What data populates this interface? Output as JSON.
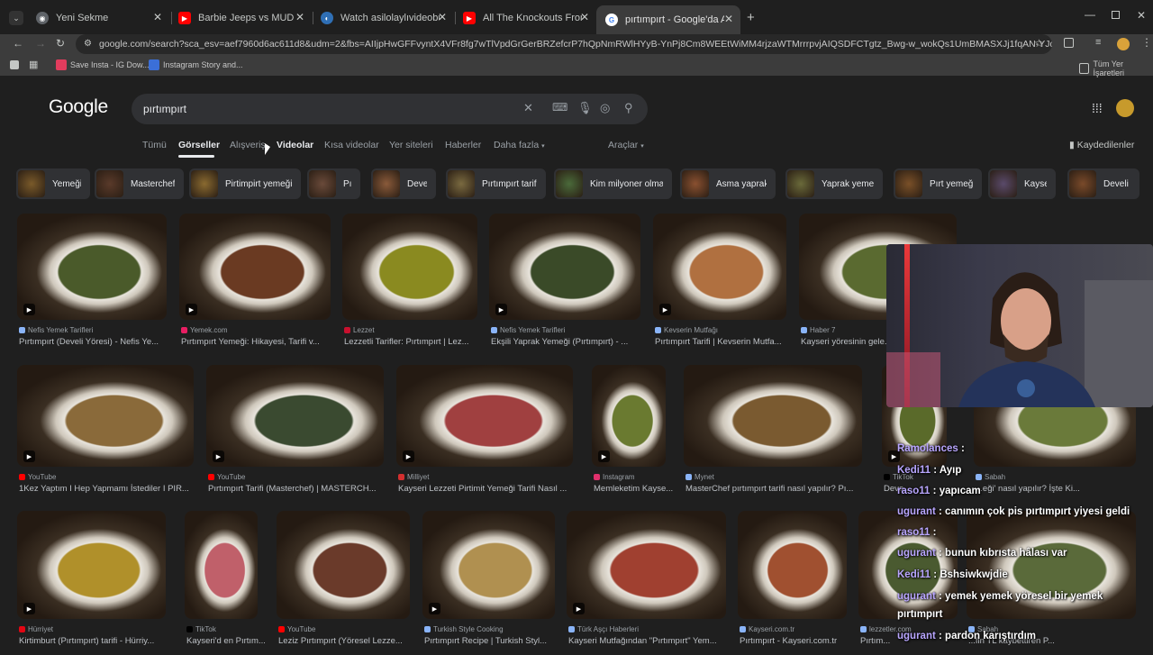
{
  "tabs": [
    {
      "title": "Yeni Sekme",
      "color": "#5f6368"
    },
    {
      "title": "Barbie Jeeps vs MUD HILL (Big",
      "color": "#ff0000"
    },
    {
      "title": "Watch asilolaylıvideobu | Strea",
      "color": "#2f6fb5"
    },
    {
      "title": "All The Knockouts From Battleb",
      "color": "#ff0000"
    },
    {
      "title": "pırtımpırt - Google'da Ara",
      "color": "#ffffff"
    }
  ],
  "address": "google.com/search?sca_esv=aef7960d6ac611d8&udm=2&fbs=AIIjpHwGFFvyntX4VFr8fg7wTlVpdGrGerBRZefcrP7hQpNmRWlHYyB-YnPj8Cm8WEEtWiMM4rjzaWTMrrrpvjAIQSDFCTgtz_Bwg-w_wokQs1UmBMASXJj1fqAN-YJdqzdVOUcg1N64DlGFDxc2C...",
  "bookmarks": [
    "Save Insta - IG Dow...",
    "Instagram Story and...",
    "Tüm Yer İşaretleri"
  ],
  "logo": "Google",
  "query": "pırtımpırt",
  "nav": [
    "Tümü",
    "Görseller",
    "Alışveriş",
    "Videolar",
    "Kısa videolar",
    "Yer siteleri",
    "Haberler",
    "Daha fazla",
    "Araçlar",
    "Kaydedilenler"
  ],
  "chips": [
    "Yemeği",
    "Masterchef",
    "Pirtimpirt yemeği",
    "Pırt",
    "Develi",
    "Pırtımpırt tarifi",
    "Kim milyoner olmak",
    "Asma yapraklı",
    "Yaprak yemegi",
    "Pırt yemeği",
    "Kayseri",
    "Develi y"
  ],
  "row1": [
    {
      "src": "Nefis Yemek Tarifleri",
      "title": "Pırtımpırt (Develi Yöresi) - Nefis Ye..."
    },
    {
      "src": "Yemek.com",
      "title": "Pırtımpırt Yemeği: Hikayesi, Tarifi v..."
    },
    {
      "src": "Lezzet",
      "title": "Lezzetli Tarifler: Pırtımpırt | Lez..."
    },
    {
      "src": "Nefis Yemek Tarifleri",
      "title": "Ekşili Yaprak Yemeği (Pırtımpırt) - ..."
    },
    {
      "src": "Kevserin Mutfağı",
      "title": "Pırtımpırt Tarifi | Kevserin Mutfa..."
    },
    {
      "src": "Haber 7",
      "title": "Kayseri yöresinin gele..."
    }
  ],
  "row2": [
    {
      "src": "YouTube",
      "title": "1Kez Yaptım I Hep Yapmamı İstediler I PIR..."
    },
    {
      "src": "YouTube",
      "title": "Pırtımpırt Tarifi (Masterchef) | MASTERCH..."
    },
    {
      "src": "Milliyet",
      "title": "Kayseri Lezzeti Pirtimit Yemeği Tarifi Nasıl ..."
    },
    {
      "src": "Instagram",
      "title": "Memleketim Kayse..."
    },
    {
      "src": "Mynet",
      "title": "MasterChef pırtımpırt tarifi nasıl yapılır? Pı..."
    },
    {
      "src": "TikTok",
      "title": "Deve..."
    },
    {
      "src": "Sabah",
      "title": "...eği' nasıl yapılır? İşte Ki..."
    }
  ],
  "row3": [
    {
      "src": "Hürriyet",
      "title": "Kirtimburt (Pırtımpırt) tarifi - Hürriy..."
    },
    {
      "src": "TikTok",
      "title": "Kayseri'd en Pırtım..."
    },
    {
      "src": "YouTube",
      "title": "Leziz Pırtımpırt (Yöresel Lezze..."
    },
    {
      "src": "Turkish Style Cooking",
      "title": "Pırtımpırt Recipe | Turkish Styl..."
    },
    {
      "src": "Türk Aşçı Haberleri",
      "title": "Kayseri Mutfağından \"Pırtımpırt\" Yem..."
    },
    {
      "src": "Kayseri.com.tr",
      "title": "Pırtımpırt - Kayseri.com.tr"
    },
    {
      "src": "lezzetler.com",
      "title": "Pırtım..."
    },
    {
      "src": "Sabah",
      "title": "...fin TL kaybettiren P..."
    }
  ],
  "chat": [
    {
      "user": "Ramolances",
      "msg": ""
    },
    {
      "user": "Kedi11",
      "msg": "Ayıp"
    },
    {
      "user": "raso11",
      "msg": "yapıcam"
    },
    {
      "user": "ugurant",
      "msg": "canımın çok pis pırtımpırt yiyesi geldi"
    },
    {
      "user": "raso11",
      "msg": ""
    },
    {
      "user": "ugurant",
      "msg": "bunun kıbrısta hâlası var"
    },
    {
      "user": "Kedi11",
      "msg": "Bshsiwkwjdie"
    },
    {
      "user": "ugurant",
      "msg": "yemek yemek yöresel bir yemek"
    },
    {
      "user": "",
      "msg": "pırtımpırt"
    },
    {
      "user": "ugurant",
      "msg": "pardon karıştırdım"
    }
  ],
  "colors": {
    "bg": "#1f1f1f",
    "chrome": "#3c3c3c",
    "chip": "#303134",
    "accent": "#8ab4f8",
    "chatUser": "#b9a6ff"
  }
}
